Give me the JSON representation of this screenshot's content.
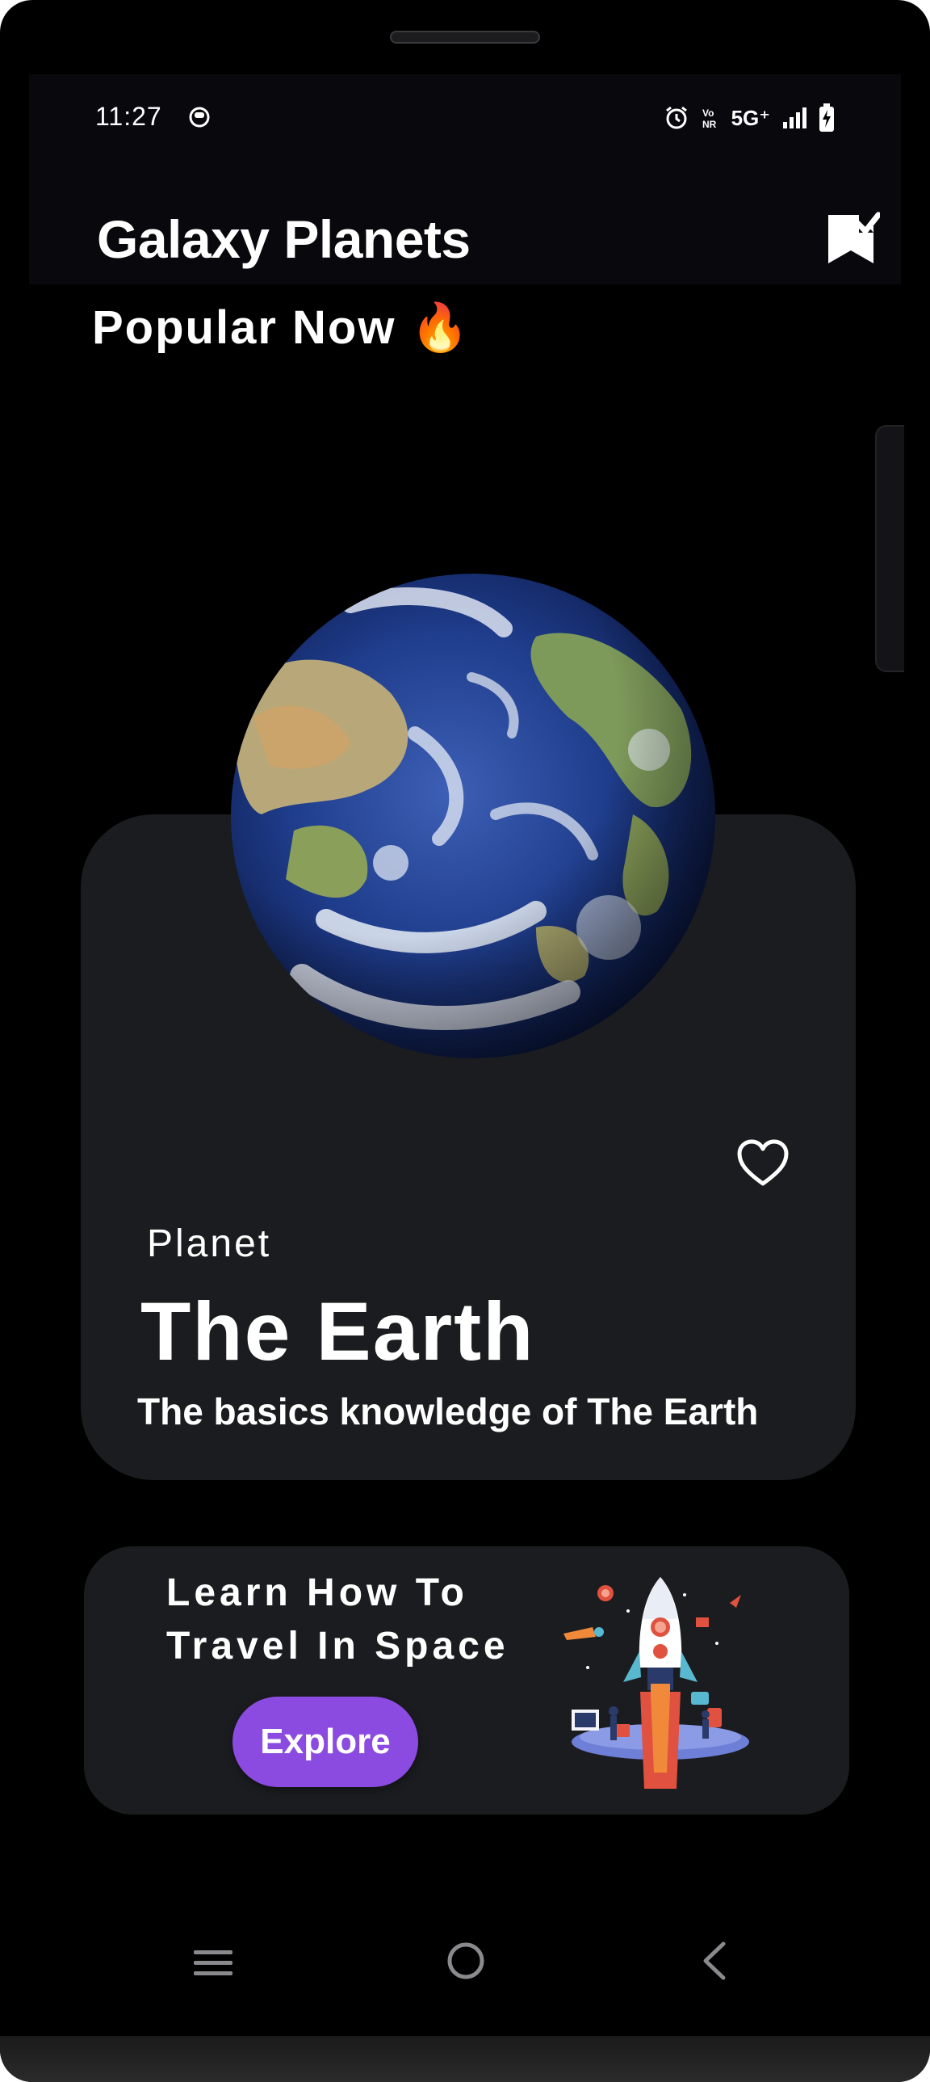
{
  "status_bar": {
    "time": "11:27",
    "network": "5G⁺",
    "icons": [
      "alarm-icon",
      "vonr-icon",
      "signal-icon",
      "battery-charging-icon"
    ]
  },
  "app_bar": {
    "title": "Galaxy Planets",
    "action_icon": "bookmark-check-icon"
  },
  "section": {
    "title": "Popular Now",
    "emoji": "🔥"
  },
  "planet_card": {
    "type": "Planet",
    "name": "The Earth",
    "description": "The basics knowledge of The Earth",
    "favorite_icon": "heart-outline-icon"
  },
  "travel_card": {
    "line1": "Learn How To",
    "line2": "Travel In Space",
    "button_label": "Explore",
    "illustration": "rocket-launch-illustration"
  },
  "nav_bar": {
    "items": [
      "recents-icon",
      "home-icon",
      "back-icon"
    ]
  },
  "colors": {
    "background": "#000000",
    "app_bar": "#09080d",
    "card": "#1b1c1f",
    "accent": "#8c4be0",
    "text": "#ffffff"
  }
}
